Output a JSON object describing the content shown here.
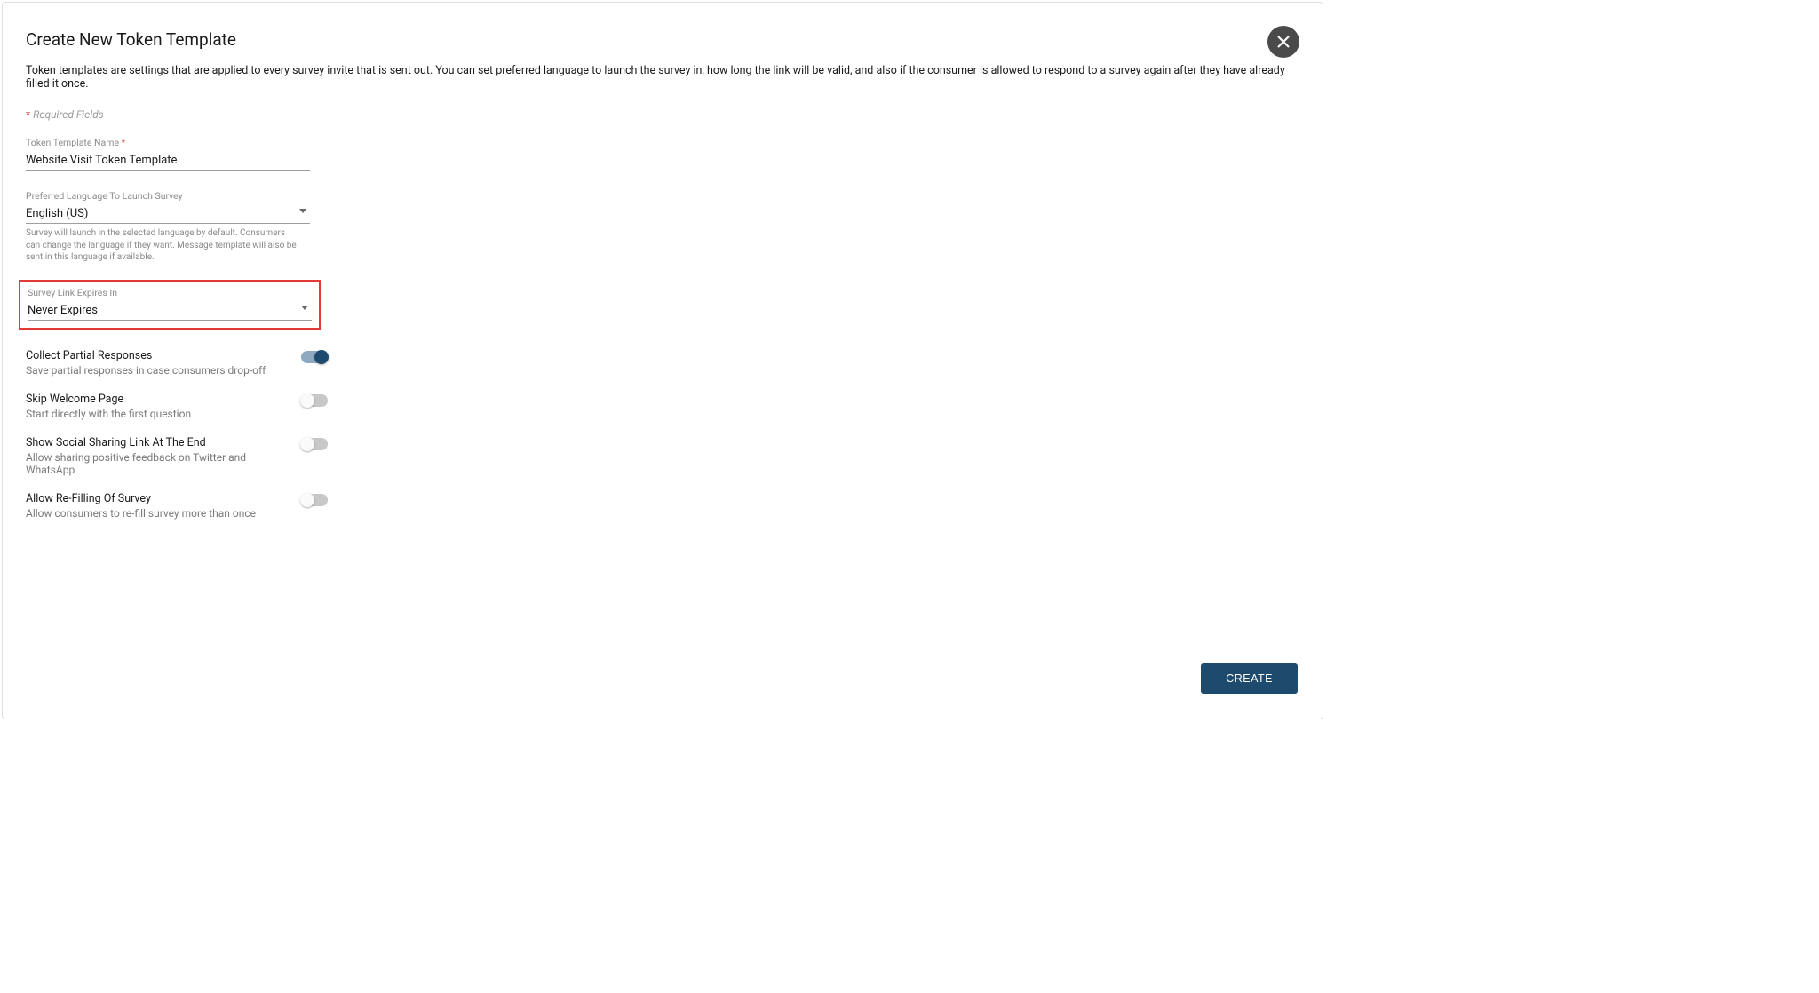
{
  "header": {
    "title": "Create New Token Template",
    "description": "Token templates are settings that are applied to every survey invite that is sent out. You can set preferred language to launch the survey in, how long the link will be valid, and also if the consumer is allowed to respond to a survey again after they have already filled it once.",
    "required_note": "Required Fields"
  },
  "fields": {
    "name": {
      "label": "Token Template Name",
      "value": "Website Visit Token Template"
    },
    "language": {
      "label": "Preferred Language To Launch Survey",
      "value": "English (US)",
      "helper": "Survey will launch in the selected language by default. Consumers can change the language if they want. Message template will also be sent in this language if available."
    },
    "expires": {
      "label": "Survey Link Expires In",
      "value": "Never Expires"
    }
  },
  "toggles": {
    "partial": {
      "title": "Collect Partial Responses",
      "sub": "Save partial responses in case consumers drop-off",
      "on": true
    },
    "skip": {
      "title": "Skip Welcome Page",
      "sub": "Start directly with the first question",
      "on": false
    },
    "social": {
      "title": "Show Social Sharing Link At The End",
      "sub": "Allow sharing positive feedback on Twitter and WhatsApp",
      "on": false
    },
    "refill": {
      "title": "Allow Re-Filling Of Survey",
      "sub": "Allow consumers to re-fill survey more than once",
      "on": false
    }
  },
  "buttons": {
    "create": "CREATE"
  }
}
